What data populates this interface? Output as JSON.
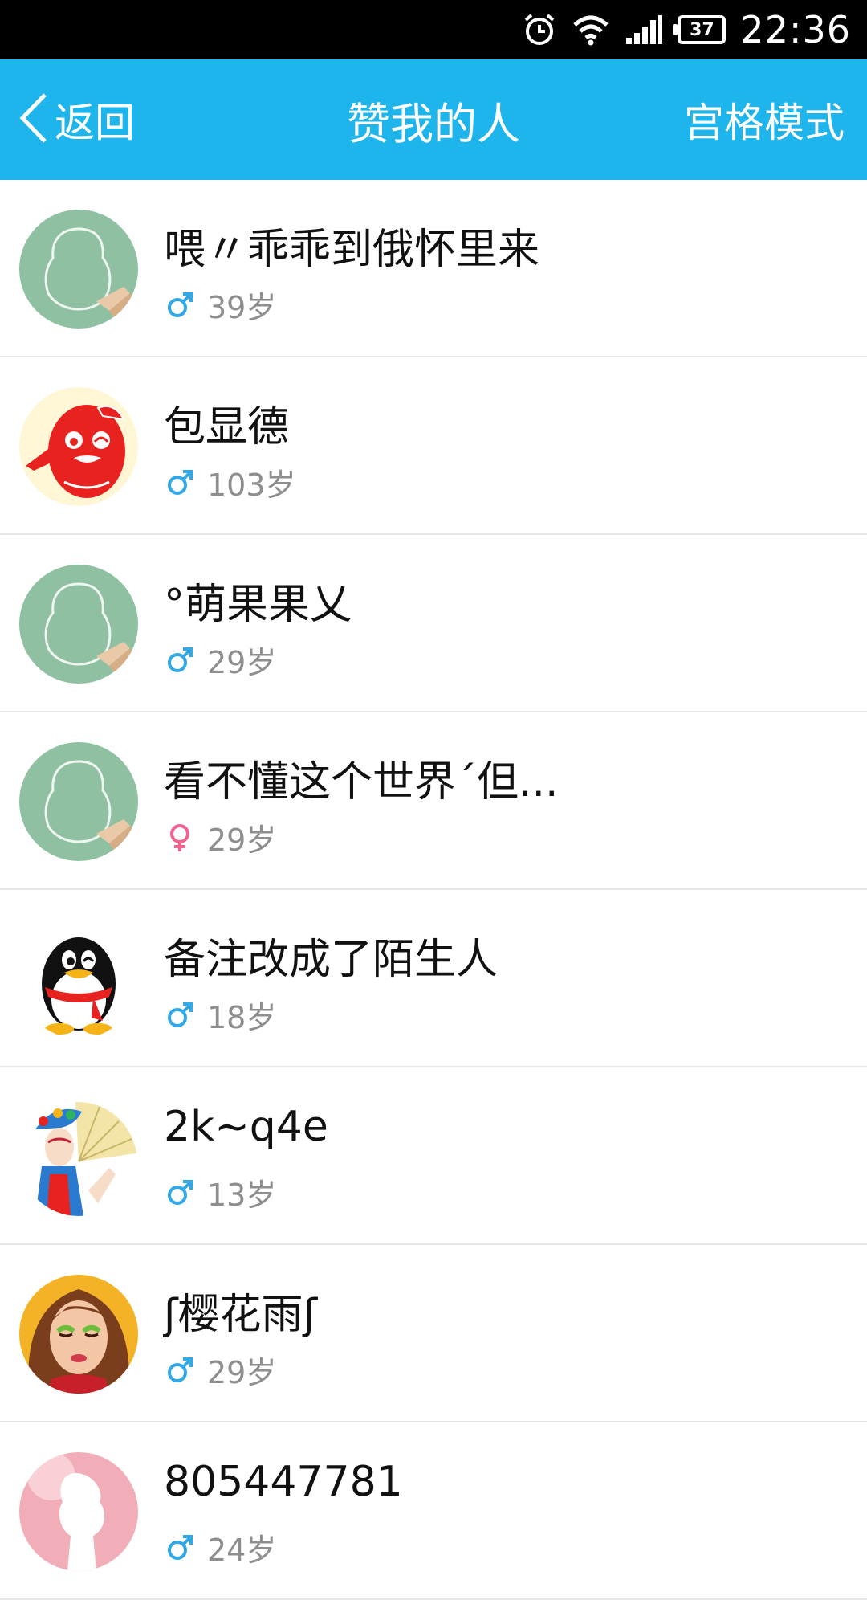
{
  "status_bar": {
    "time": "22:36",
    "battery": "37",
    "icons": [
      "alarm-icon",
      "wifi-icon",
      "signal-icon",
      "battery-icon"
    ]
  },
  "header": {
    "back_label": "返回",
    "title": "赞我的人",
    "right_action": "宫格模式"
  },
  "colors": {
    "header_bg": "#1eb4ec",
    "male": "#33a8e6",
    "female": "#f0648f"
  },
  "users": [
    {
      "name": "喂〃乖乖到俄怀里来",
      "gender": "male",
      "age": "39岁",
      "avatar": "default-avatar"
    },
    {
      "name": "包显德",
      "gender": "male",
      "age": "103岁",
      "avatar": "red-penguin-avatar"
    },
    {
      "name": "°萌果果乂",
      "gender": "male",
      "age": "29岁",
      "avatar": "default-avatar"
    },
    {
      "name": "看不懂这个世界ˊ但...",
      "gender": "female",
      "age": "29岁",
      "avatar": "default-avatar"
    },
    {
      "name": "备注改成了陌生人",
      "gender": "male",
      "age": "18岁",
      "avatar": "qq-penguin-avatar"
    },
    {
      "name": "2k~q4e",
      "gender": "male",
      "age": "13岁",
      "avatar": "opera-avatar"
    },
    {
      "name": "ʃ樱花雨ʃ",
      "gender": "male",
      "age": "29岁",
      "avatar": "woman-avatar"
    },
    {
      "name": "805447781",
      "gender": "male",
      "age": "24岁",
      "avatar": "pink-avatar"
    }
  ]
}
